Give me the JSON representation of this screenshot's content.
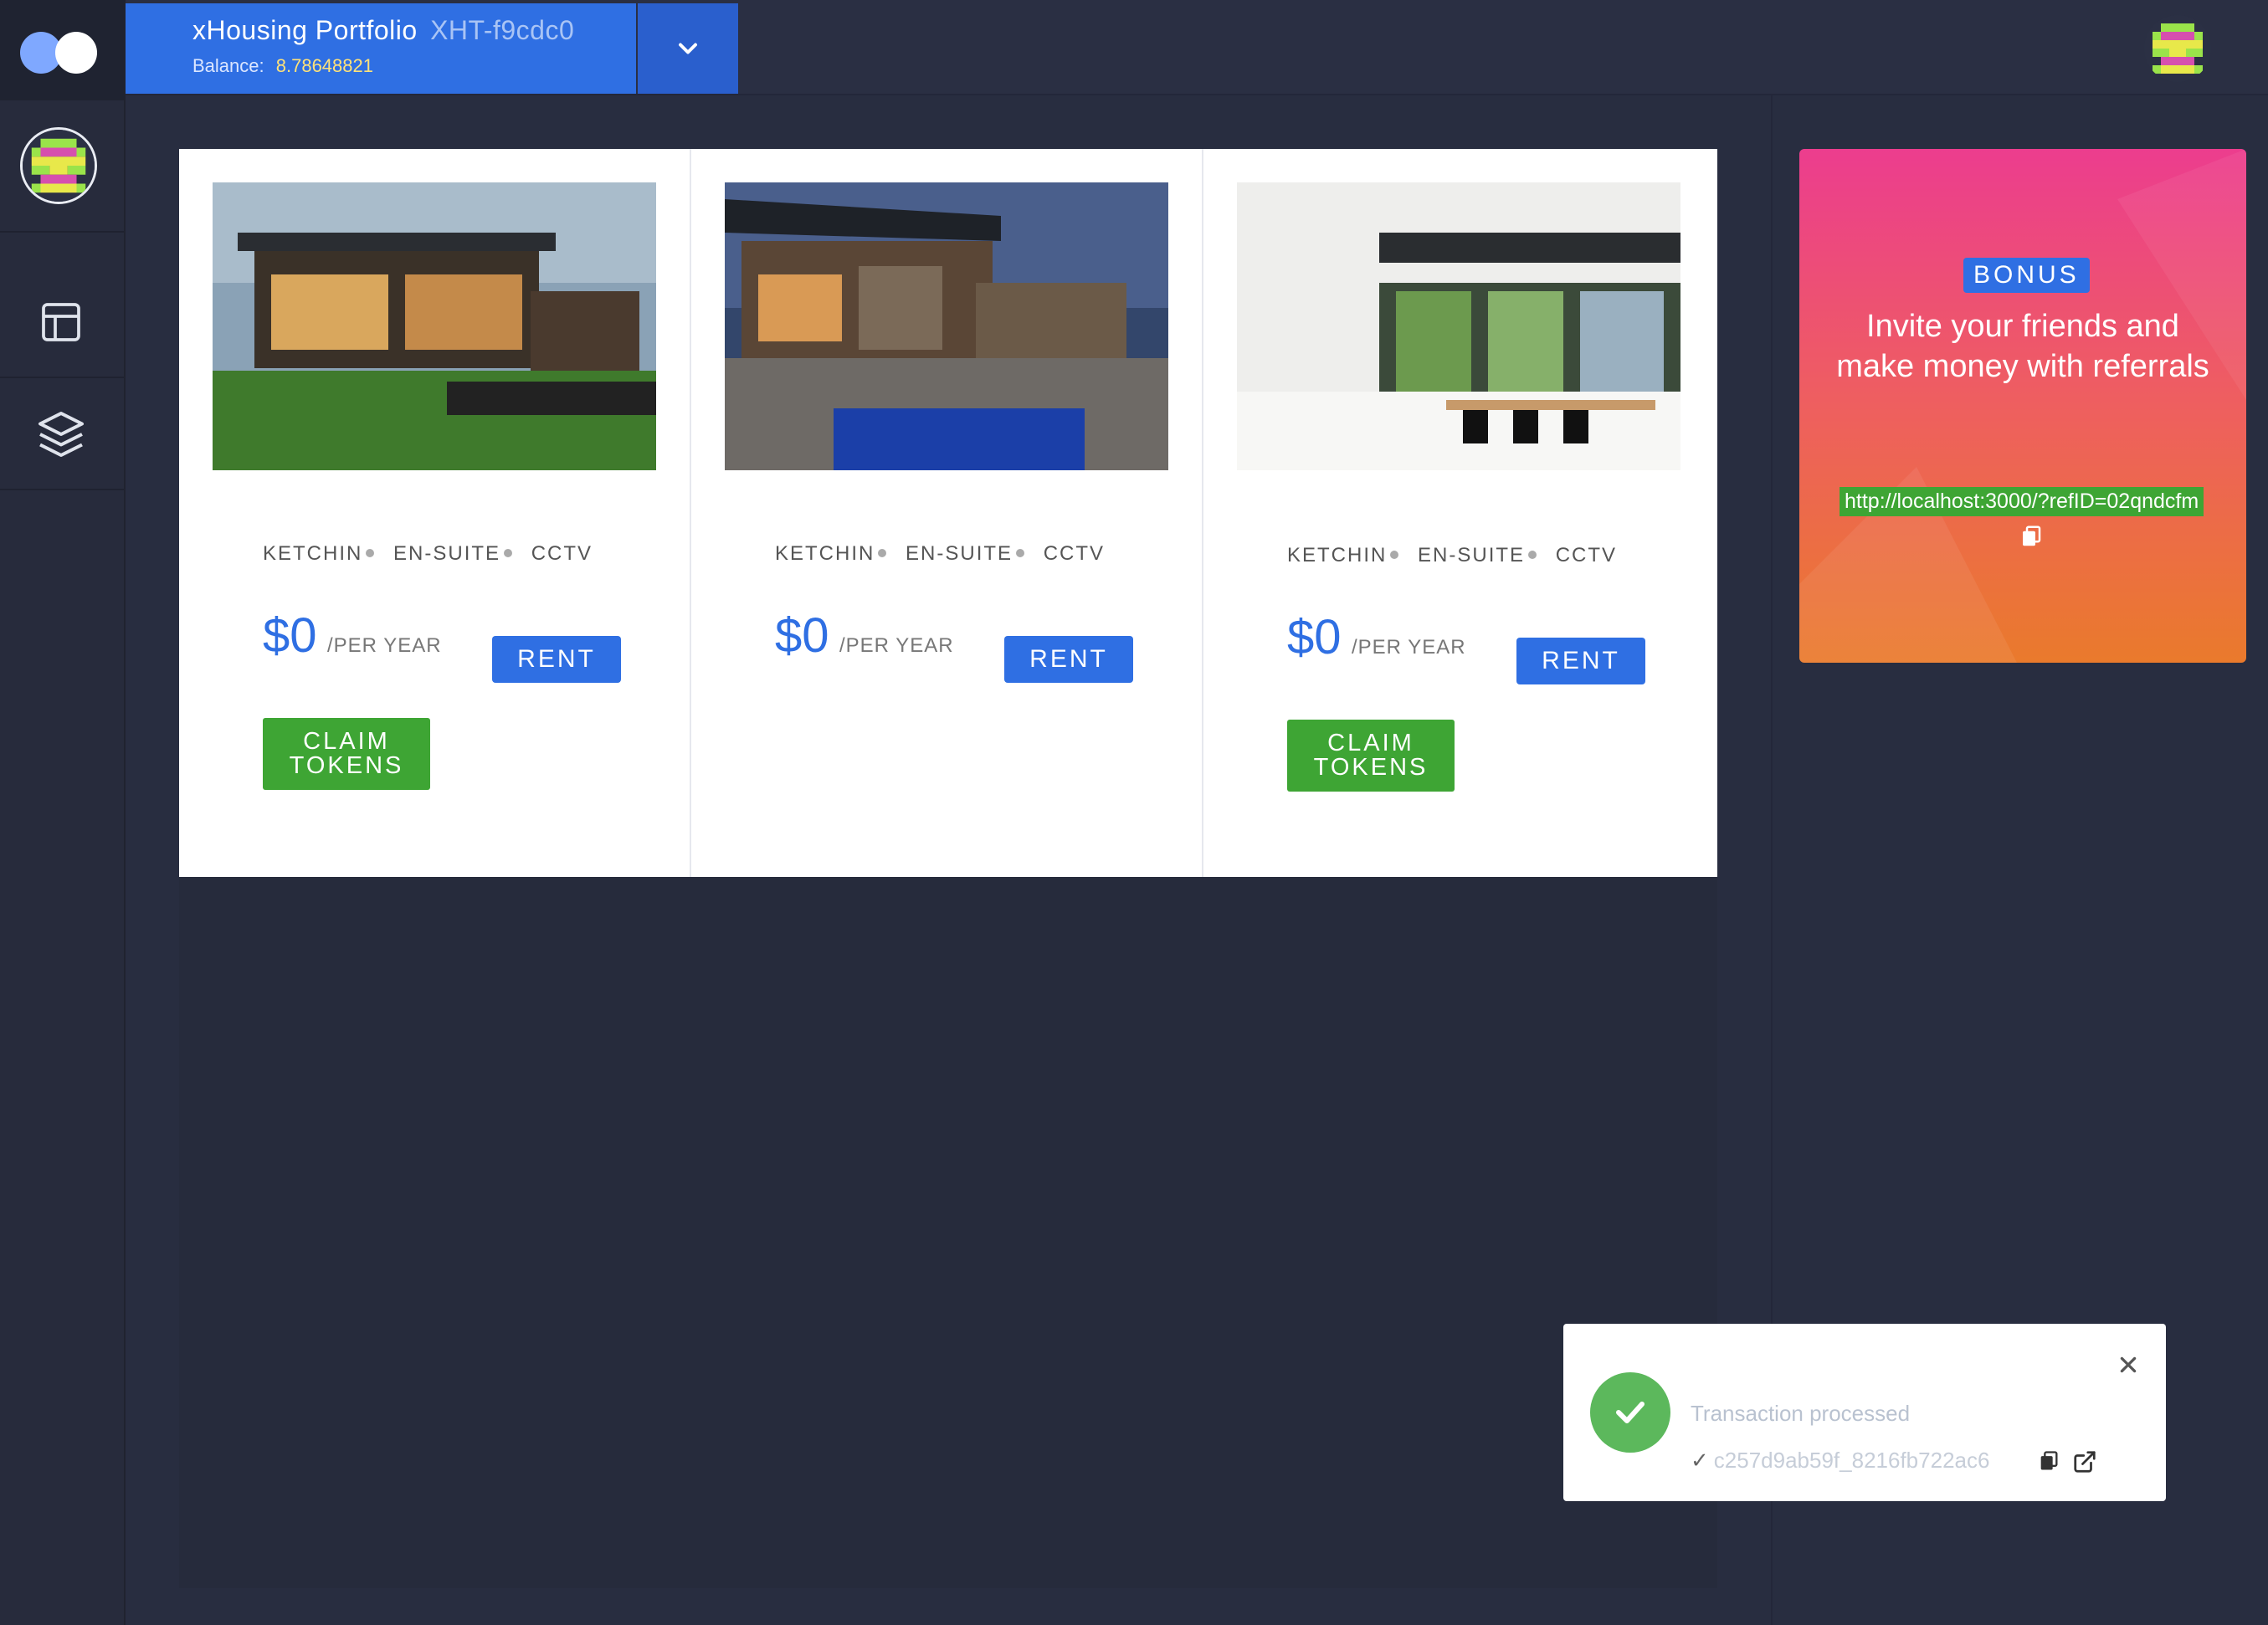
{
  "header": {
    "portfolio_name": "xHousing Portfolio",
    "portfolio_id": "XHT-f9cdc0",
    "balance_label": "Balance:",
    "balance_value": "8.78648821"
  },
  "sidebar": {
    "items": [
      {
        "name": "dashboard-icon"
      },
      {
        "name": "layers-icon"
      }
    ]
  },
  "properties": [
    {
      "features": [
        "KETCHIN",
        "EN-SUITE",
        "CCTV"
      ],
      "price": "$0",
      "period": "/PER YEAR",
      "rent_label": "RENT",
      "claim_label_1": "CLAIM",
      "claim_label_2": "TOKENS"
    },
    {
      "features": [
        "KETCHIN",
        "EN-SUITE",
        "CCTV"
      ],
      "price": "$0",
      "period": "/PER YEAR",
      "rent_label": "RENT"
    },
    {
      "features": [
        "KETCHIN",
        "EN-SUITE",
        "CCTV"
      ],
      "price": "$0",
      "period": "/PER YEAR",
      "rent_label": "RENT",
      "claim_label_1": "CLAIM",
      "claim_label_2": "TOKENS"
    }
  ],
  "bonus": {
    "badge": "BONUS",
    "text": "Invite your friends and make money with referrals",
    "link": "http://localhost:3000/?refID=02qndcfm"
  },
  "toast": {
    "title": "Transaction processed",
    "hash": "c257d9ab59f_8216fb722ac6"
  },
  "colors": {
    "accent": "#2f6fe3",
    "success": "#3ea534",
    "background": "#282d40"
  }
}
